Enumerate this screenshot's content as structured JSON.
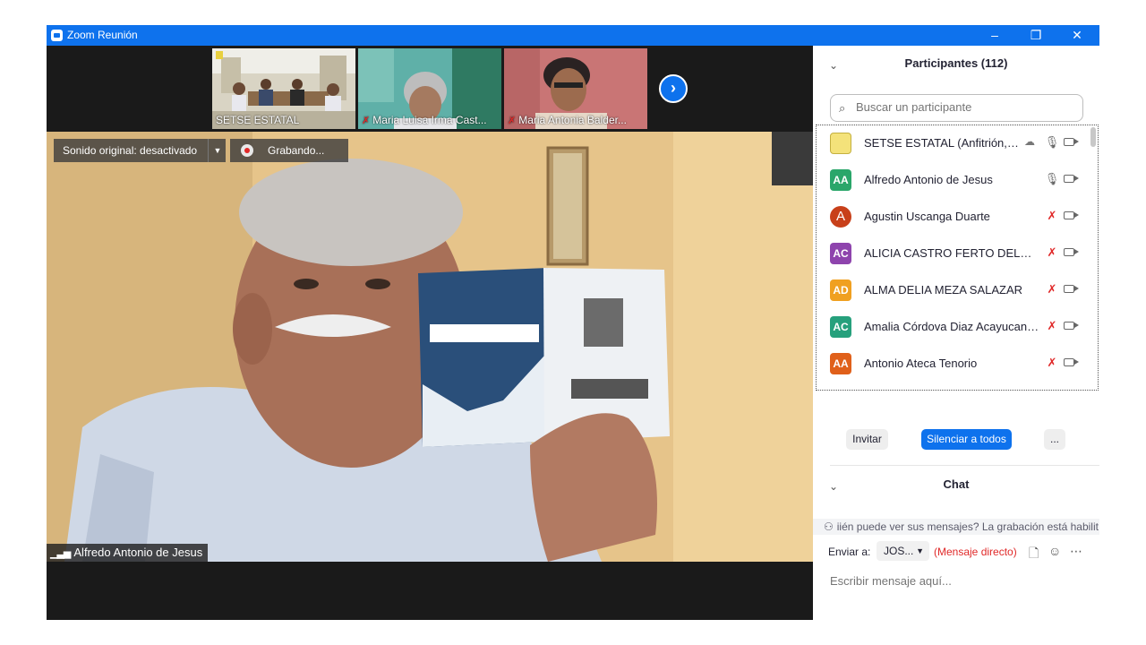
{
  "window": {
    "title": "Zoom Reunión",
    "minimize_icon": "–",
    "restore_icon": "❐",
    "close_icon": "✕"
  },
  "thumbnails": [
    {
      "name": "SETSE ESTATAL",
      "muted": false
    },
    {
      "name": "Maria Luisa Irma Cast...",
      "muted": true
    },
    {
      "name": "Maria Antonia Balder...",
      "muted": true
    }
  ],
  "next_page_icon": "›",
  "stage": {
    "audio_label": "Sonido original: desactivado",
    "recording_label": "Grabando...",
    "speaker_name": "Alfredo Antonio de Jesus"
  },
  "participants": {
    "title": "Participantes (112)",
    "search_placeholder": "Buscar un participante",
    "items": [
      {
        "initials": "",
        "name": "SETSE ESTATAL (Anfitrión, yo)",
        "color": "#f4e27a",
        "muted": false,
        "host": true
      },
      {
        "initials": "AA",
        "name": "Alfredo Antonio de Jesus",
        "color": "#2aa66a",
        "muted": false,
        "host": false
      },
      {
        "initials": "A",
        "name": "Agustin Uscanga Duarte",
        "color": "#c8401a",
        "muted": true,
        "host": false
      },
      {
        "initials": "AC",
        "name": "ALICIA CASTRO FERTO DELEGAC...",
        "color": "#8e44ad",
        "muted": true,
        "host": false
      },
      {
        "initials": "AD",
        "name": "ALMA DELIA MEZA SALAZAR",
        "color": "#f0a020",
        "muted": true,
        "host": false
      },
      {
        "initials": "AC",
        "name": "Amalia Córdova Diaz Acayucan ...",
        "color": "#26a07c",
        "muted": true,
        "host": false
      },
      {
        "initials": "AA",
        "name": "Antonio Ateca Tenorio",
        "color": "#e0601a",
        "muted": true,
        "host": false
      }
    ],
    "invite_label": "Invitar",
    "mute_all_label": "Silenciar a todos",
    "more_label": "..."
  },
  "chat": {
    "title": "Chat",
    "notice": "iién puede ver sus mensajes? La grabación está habilit",
    "send_to_label": "Enviar a:",
    "recipient": "JOS...",
    "direct_label": "(Mensaje directo)",
    "input_placeholder": "Escribir mensaje aquí..."
  },
  "colors": {
    "zoom_blue": "#0e72ed",
    "muted_red": "#e02828"
  }
}
